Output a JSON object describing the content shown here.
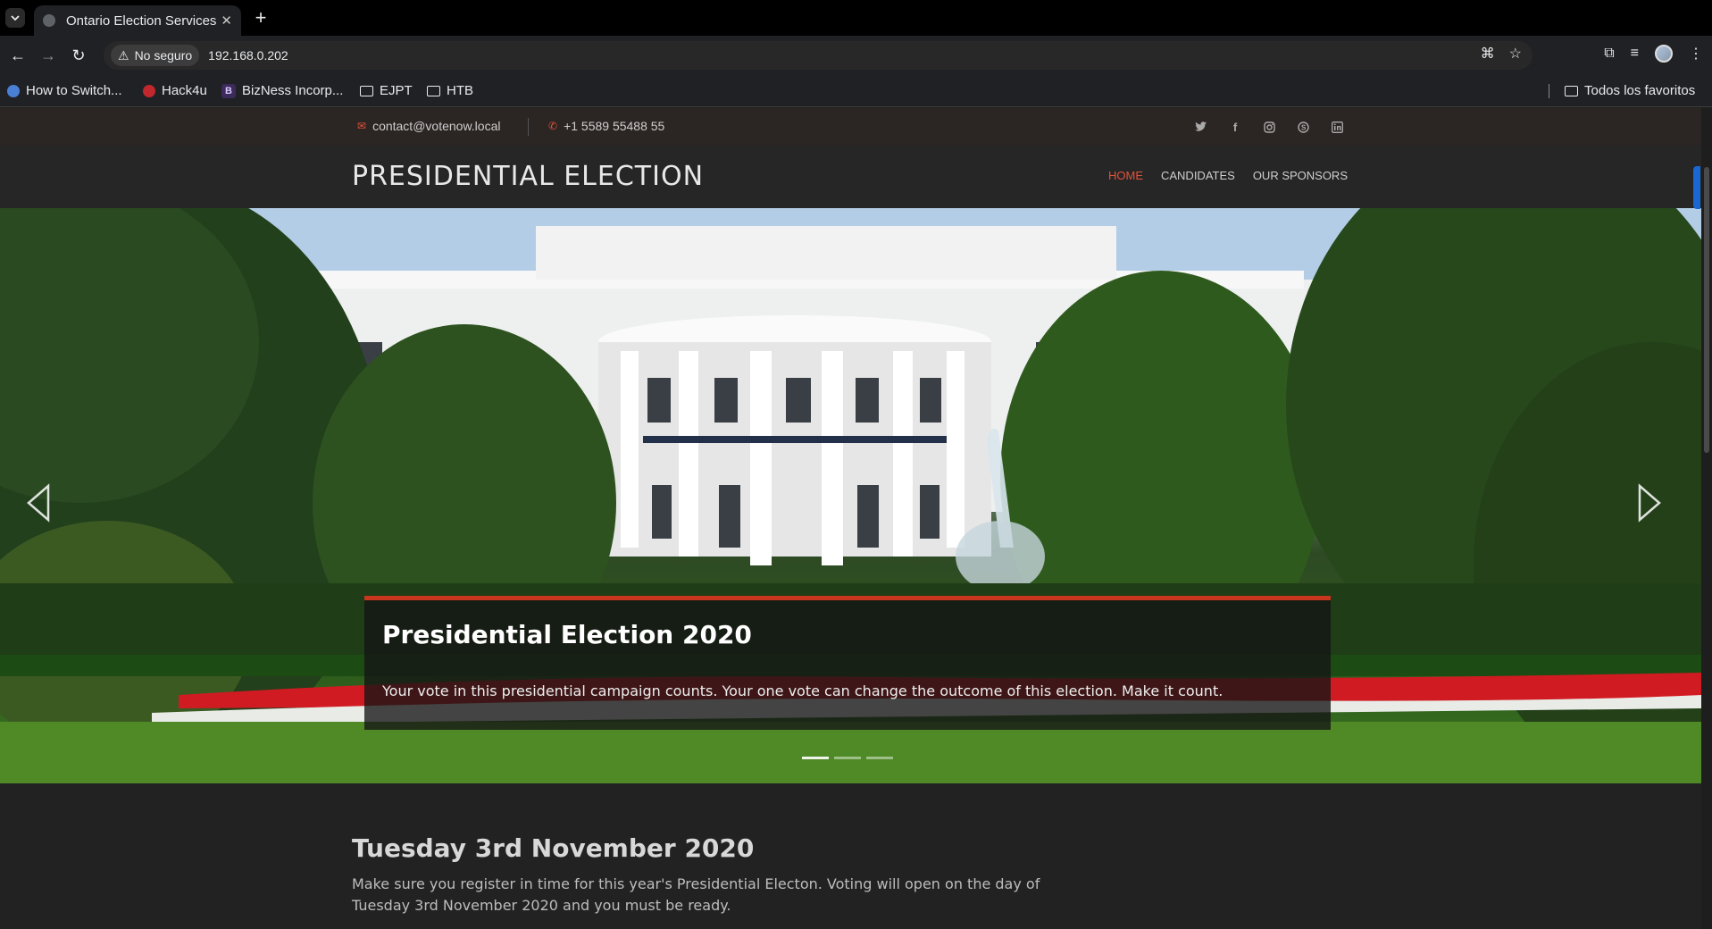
{
  "browser": {
    "tab_title": "Ontario Election Services",
    "security_label": "No seguro",
    "url": "192.168.0.202",
    "bookmarks": [
      {
        "label": "How to Switch...",
        "icon": "info-icon"
      },
      {
        "label": "Hack4u",
        "icon": "hack4u-icon"
      },
      {
        "label": "BizNess Incorp...",
        "icon": "b-icon"
      },
      {
        "label": "EJPT",
        "icon": "folder-icon"
      },
      {
        "label": "HTB",
        "icon": "folder-icon"
      }
    ],
    "all_bookmarks": "Todos los favoritos"
  },
  "site": {
    "email": "contact@votenow.local",
    "phone": "+1 5589 55488 55",
    "socials": [
      "twitter-icon",
      "facebook-icon",
      "instagram-icon",
      "skype-icon",
      "linkedin-icon"
    ],
    "logo": "PRESIDENTIAL ELECTION",
    "nav": [
      {
        "label": "HOME",
        "active": true
      },
      {
        "label": "CANDIDATES",
        "active": false
      },
      {
        "label": "OUR SPONSORS",
        "active": false
      }
    ],
    "accent_color": "#e0533a"
  },
  "hero": {
    "title": "Presidential Election 2020",
    "text": "Your vote in this presidential campaign counts. Your one vote can change the outcome of this election. Make it count."
  },
  "section": {
    "heading": "Tuesday 3rd November 2020",
    "body": "Make sure you register in time for this year's Presidential Electon. Voting will open on the day of Tuesday 3rd November 2020 and you must be ready."
  }
}
